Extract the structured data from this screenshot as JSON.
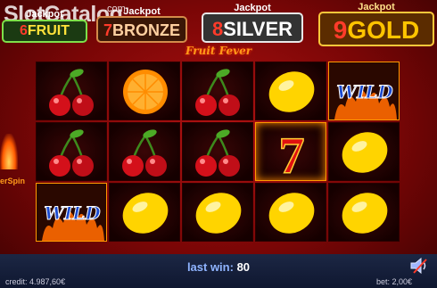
{
  "watermark": {
    "text": "SlotCatalog",
    "com": ".com"
  },
  "jackpots": [
    {
      "caption": "Jackpot",
      "number": "6",
      "name": "FRUIT"
    },
    {
      "caption": "Jackpot",
      "number": "7",
      "name": "BRONZE"
    },
    {
      "caption": "Jackpot",
      "number": "8",
      "name": "SILVER"
    },
    {
      "caption": "Jackpot",
      "number": "9",
      "name": "GOLD"
    }
  ],
  "game_title": "Fruit Fever",
  "side_feature_label": "erSpin",
  "reels": [
    [
      "cherry",
      "cherry",
      "wild"
    ],
    [
      "orange",
      "cherry",
      "lemon"
    ],
    [
      "cherry",
      "cherry",
      "lemon"
    ],
    [
      "lemon",
      "seven",
      "lemon"
    ],
    [
      "wild",
      "lemon",
      "lemon"
    ]
  ],
  "symbol_labels": {
    "wild": "WILD",
    "seven": "7"
  },
  "status": {
    "last_win_label": "last win:",
    "last_win_value": "80",
    "credit_label": "credit:",
    "credit_value": "4.987,60€",
    "bet_label": "bet:",
    "bet_value": "2,00€"
  },
  "icons": {
    "sound": "speaker-icon"
  },
  "colors": {
    "background": "#8a0606",
    "gold": "#ffc400",
    "lemon": "#ffd400",
    "cherry": "#d4101a"
  }
}
